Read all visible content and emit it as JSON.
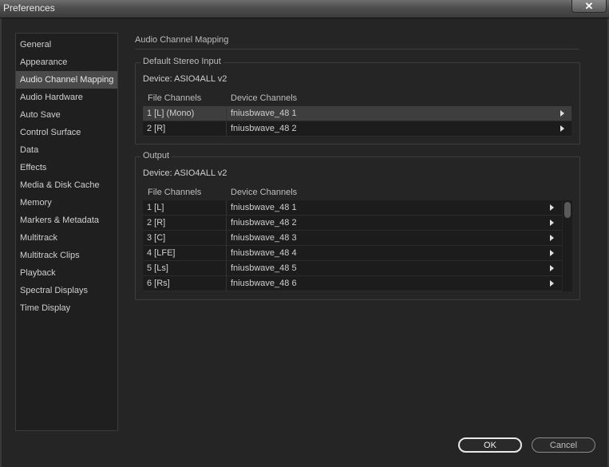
{
  "window": {
    "title": "Preferences",
    "close_label": "X"
  },
  "sidebar": {
    "items": [
      {
        "label": "General",
        "active": false
      },
      {
        "label": "Appearance",
        "active": false
      },
      {
        "label": "Audio Channel Mapping",
        "active": true
      },
      {
        "label": "Audio Hardware",
        "active": false
      },
      {
        "label": "Auto Save",
        "active": false
      },
      {
        "label": "Control Surface",
        "active": false
      },
      {
        "label": "Data",
        "active": false
      },
      {
        "label": "Effects",
        "active": false
      },
      {
        "label": "Media & Disk Cache",
        "active": false
      },
      {
        "label": "Memory",
        "active": false
      },
      {
        "label": "Markers & Metadata",
        "active": false
      },
      {
        "label": "Multitrack",
        "active": false
      },
      {
        "label": "Multitrack Clips",
        "active": false
      },
      {
        "label": "Playback",
        "active": false
      },
      {
        "label": "Spectral Displays",
        "active": false
      },
      {
        "label": "Time Display",
        "active": false
      }
    ]
  },
  "main": {
    "section_title": "Audio Channel Mapping",
    "stereo_input": {
      "group_label": "Default Stereo Input",
      "device": "Device: ASIO4ALL v2",
      "headers": {
        "file": "File Channels",
        "device": "Device Channels"
      },
      "rows": [
        {
          "file": "1 [L] (Mono)",
          "device": "fniusbwave_48 1",
          "selected": true
        },
        {
          "file": "2 [R]",
          "device": "fniusbwave_48 2",
          "selected": false
        }
      ]
    },
    "output": {
      "group_label": "Output",
      "device": "Device: ASIO4ALL v2",
      "headers": {
        "file": "File Channels",
        "device": "Device Channels"
      },
      "rows": [
        {
          "file": "1 [L]",
          "device": "fniusbwave_48 1"
        },
        {
          "file": "2 [R]",
          "device": "fniusbwave_48 2"
        },
        {
          "file": "3 [C]",
          "device": "fniusbwave_48 3"
        },
        {
          "file": "4 [LFE]",
          "device": "fniusbwave_48 4"
        },
        {
          "file": "5 [Ls]",
          "device": "fniusbwave_48 5"
        },
        {
          "file": "6 [Rs]",
          "device": "fniusbwave_48 6"
        }
      ]
    }
  },
  "buttons": {
    "ok": "OK",
    "cancel": "Cancel"
  }
}
